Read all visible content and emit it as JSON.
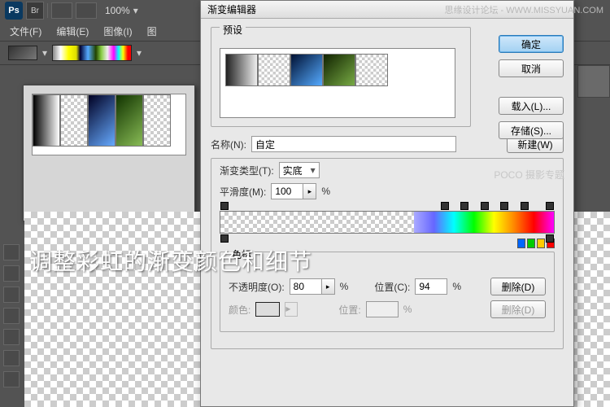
{
  "topbar": {
    "zoom": "100%"
  },
  "menubar": {
    "file": "文件(F)",
    "edit": "编辑(E)",
    "image": "图像(I)",
    "more": "图"
  },
  "dialog": {
    "title": "渐变编辑器",
    "presets_label": "预设",
    "buttons": {
      "ok": "确定",
      "cancel": "取消",
      "load": "载入(L)...",
      "save": "存储(S)...",
      "new": "新建(W)",
      "delete": "删除(D)"
    },
    "name_label": "名称(N):",
    "name_value": "自定",
    "type_label": "渐变类型(T):",
    "type_value": "实底",
    "smooth_label": "平滑度(M):",
    "smooth_value": "100",
    "pct": "%",
    "stops_label": "色标",
    "opacity_label": "不透明度(O):",
    "opacity_value": "80",
    "color_label": "颜色:",
    "pos_label": "位置(C):",
    "pos_value": "94",
    "pos2_label": "位置:"
  },
  "overlay": "调整彩虹的渐变颜色和细节",
  "watermark": "思缘设计论坛 - WWW.MISSYUAN.COM",
  "watermark2": "POCO 摄影专题"
}
